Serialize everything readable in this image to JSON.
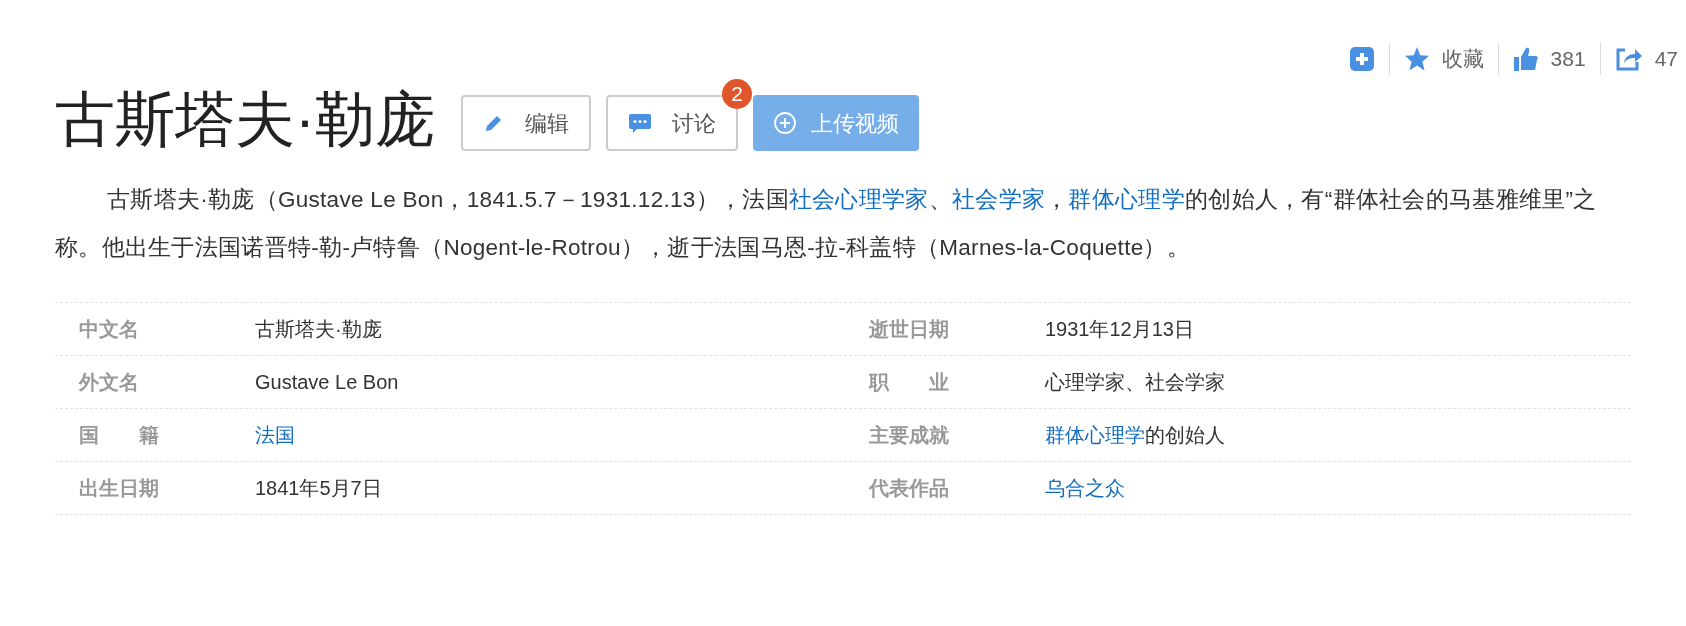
{
  "toolbar": {
    "favorite_label": "收藏",
    "like_count": "381",
    "share_count": "47"
  },
  "title": "古斯塔夫·勒庞",
  "buttons": [
    {
      "kind": "edit",
      "label": "编辑"
    },
    {
      "kind": "discuss",
      "label": "讨论",
      "badge": "2"
    },
    {
      "kind": "upload",
      "label": "上传视频"
    }
  ],
  "summary": [
    {
      "kind": "text",
      "text": "古斯塔夫·勒庞（Gustave Le Bon，1841.5.7－1931.12.13），法国"
    },
    {
      "kind": "link",
      "text": "社会心理学家"
    },
    {
      "kind": "text",
      "text": "、"
    },
    {
      "kind": "link",
      "text": "社会学家"
    },
    {
      "kind": "text",
      "text": "，"
    },
    {
      "kind": "link",
      "text": "群体心理学"
    },
    {
      "kind": "text",
      "text": "的创始人，有“群体社会的马基雅维里”之称。他出生于法国诺晋特-勒-卢特鲁（Nogent-le-Rotrou），逝于法国马恩-拉-科盖特（Marnes-la-Coquette）。"
    }
  ],
  "info_rows": [
    {
      "left": {
        "label": "中文名",
        "value": [
          {
            "kind": "text",
            "text": "古斯塔夫·勒庞"
          }
        ]
      },
      "right": {
        "label": "逝世日期",
        "value": [
          {
            "kind": "text",
            "text": "1931年12月13日"
          }
        ]
      }
    },
    {
      "left": {
        "label": "外文名",
        "value": [
          {
            "kind": "text",
            "text": "Gustave Le Bon"
          }
        ]
      },
      "right": {
        "label": "职　　业",
        "value": [
          {
            "kind": "text",
            "text": "心理学家、社会学家"
          }
        ]
      }
    },
    {
      "left": {
        "label": "国　　籍",
        "value": [
          {
            "kind": "link",
            "text": "法国"
          }
        ]
      },
      "right": {
        "label": "主要成就",
        "value": [
          {
            "kind": "link",
            "text": "群体心理学"
          },
          {
            "kind": "text",
            "text": "的创始人"
          }
        ]
      }
    },
    {
      "left": {
        "label": "出生日期",
        "value": [
          {
            "kind": "text",
            "text": "1841年5月7日"
          }
        ]
      },
      "right": {
        "label": "代表作品",
        "value": [
          {
            "kind": "link",
            "text": "乌合之众"
          }
        ]
      }
    }
  ]
}
